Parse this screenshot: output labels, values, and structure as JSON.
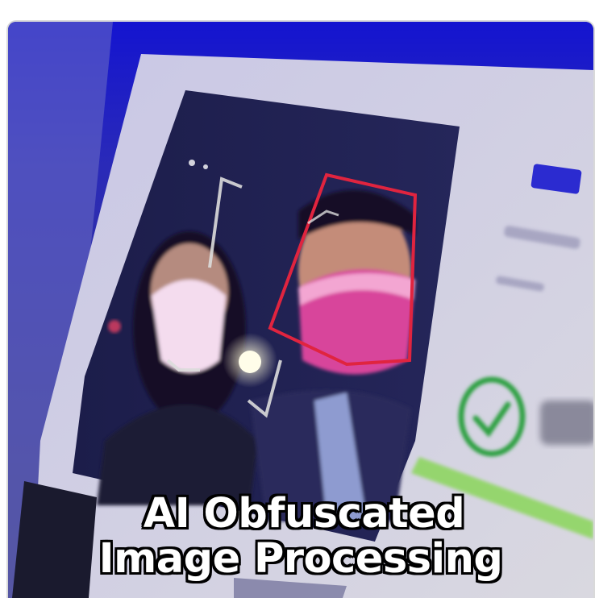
{
  "caption": {
    "line1": "AI Obfuscated",
    "line2": "Image Processing"
  },
  "colors": {
    "blue_wash": "#1b1bd6",
    "face_box_red": "#e0243f",
    "face_box_white": "#dcdcdc",
    "check_green": "#2ea043",
    "progress_green": "#8ad65a",
    "caption_fill": "#ffffff",
    "caption_outline": "#000000"
  },
  "scene": {
    "subject": "face recognition screen with two masked faces",
    "icons": [
      "face-detect-box",
      "check-circle-icon"
    ]
  }
}
